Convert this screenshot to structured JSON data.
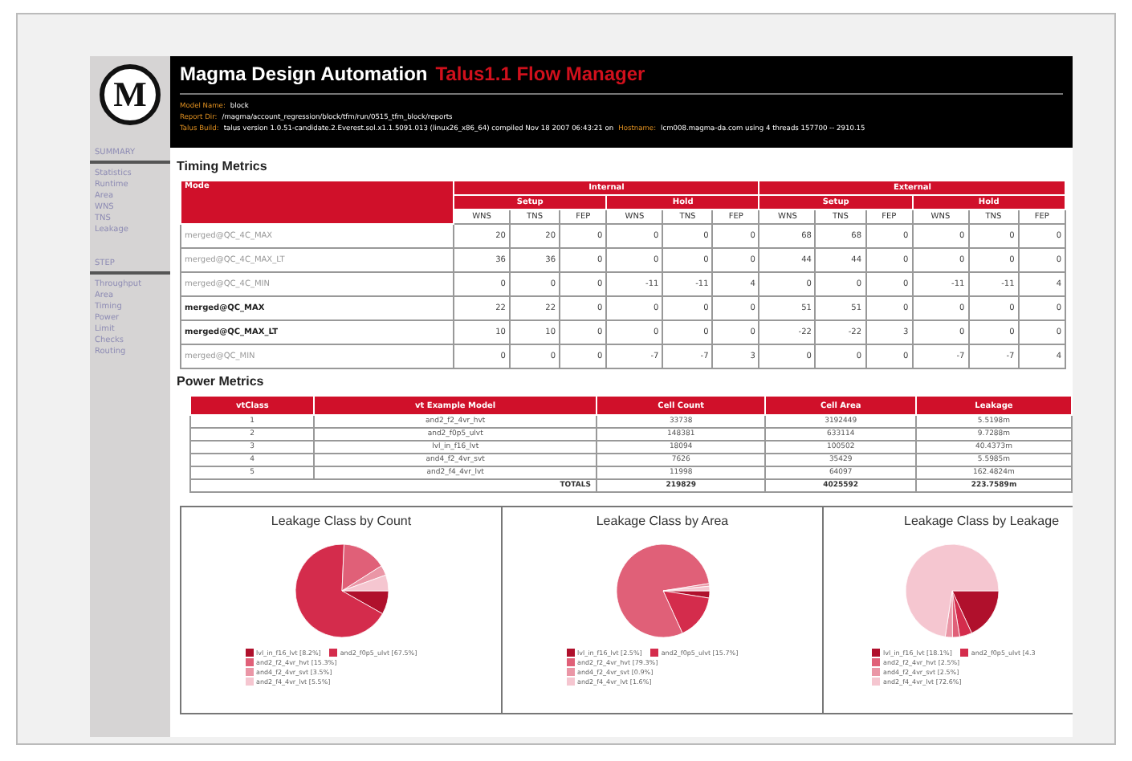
{
  "logo": {
    "text": "M"
  },
  "header": {
    "title": "Magma Design Automation",
    "subtitle": "Talus1.1 Flow Manager",
    "info": [
      {
        "label": "Model Name:",
        "value": "block"
      },
      {
        "label": "Report Dir:",
        "value": "/magma/account_regression/block/tfm/run/0515_tfm_block/reports"
      },
      {
        "label": "Talus Build:",
        "value": "talus version 1.0.51-candidate.2.Everest.sol.x1.1.5091.013 (linux26_x86_64) compiled Nov 18 2007 06:43:21 on",
        "label2": "Hostname:",
        "value2": "lcm008.magma-da.com using 4 threads 157700 -- 2910.15"
      }
    ]
  },
  "sidebar": {
    "sections": [
      {
        "heading": "SUMMARY",
        "items": [
          "Statistics",
          "Runtime",
          "Area",
          "WNS",
          "TNS",
          "Leakage"
        ]
      },
      {
        "heading": "STEP",
        "items": [
          "Throughput",
          "Area",
          "Timing",
          "Power",
          "Limit",
          "Checks",
          "Routing"
        ]
      }
    ]
  },
  "timing": {
    "title": "Timing Metrics",
    "mode_header": "Mode",
    "groups": [
      "Internal",
      "External"
    ],
    "subgroups": [
      "Setup",
      "Hold",
      "Setup",
      "Hold"
    ],
    "metrics": [
      "WNS",
      "TNS",
      "FEP",
      "WNS",
      "TNS",
      "FEP",
      "WNS",
      "TNS",
      "FEP",
      "WNS",
      "TNS",
      "FEP"
    ],
    "rows": [
      {
        "mode": "merged@QC_4C_MAX",
        "emphasized": false,
        "values": [
          "20",
          "20",
          "0",
          "0",
          "0",
          "0",
          "68",
          "68",
          "0",
          "0",
          "0",
          "0"
        ]
      },
      {
        "mode": "merged@QC_4C_MAX_LT",
        "emphasized": false,
        "values": [
          "36",
          "36",
          "0",
          "0",
          "0",
          "0",
          "44",
          "44",
          "0",
          "0",
          "0",
          "0"
        ]
      },
      {
        "mode": "merged@QC_4C_MIN",
        "emphasized": false,
        "values": [
          "0",
          "0",
          "0",
          "-11",
          "-11",
          "4",
          "0",
          "0",
          "0",
          "-11",
          "-11",
          "4"
        ]
      },
      {
        "mode": "merged@QC_MAX",
        "emphasized": true,
        "values": [
          "22",
          "22",
          "0",
          "0",
          "0",
          "0",
          "51",
          "51",
          "0",
          "0",
          "0",
          "0"
        ]
      },
      {
        "mode": "merged@QC_MAX_LT",
        "emphasized": true,
        "values": [
          "10",
          "10",
          "0",
          "0",
          "0",
          "0",
          "-22",
          "-22",
          "3",
          "0",
          "0",
          "0"
        ]
      },
      {
        "mode": "merged@QC_MIN",
        "emphasized": false,
        "values": [
          "0",
          "0",
          "0",
          "-7",
          "-7",
          "3",
          "0",
          "0",
          "0",
          "-7",
          "-7",
          "4"
        ]
      }
    ]
  },
  "power": {
    "title": "Power Metrics",
    "columns": [
      "vtClass",
      "vt Example Model",
      "Cell Count",
      "Cell Area",
      "Leakage"
    ],
    "rows": [
      [
        "1",
        "and2_f2_4vr_hvt",
        "33738",
        "3192449",
        "5.5198m"
      ],
      [
        "2",
        "and2_f0p5_ulvt",
        "148381",
        "633114",
        "9.7288m"
      ],
      [
        "3",
        "lvl_in_f16_lvt",
        "18094",
        "100502",
        "40.4373m"
      ],
      [
        "4",
        "and4_f2_4vr_svt",
        "7626",
        "35429",
        "5.5985m"
      ],
      [
        "5",
        "and2_f4_4vr_lvt",
        "11998",
        "64097",
        "162.4824m"
      ]
    ],
    "totals": {
      "label": "TOTALS",
      "values": [
        "219829",
        "4025592",
        "223.7589m"
      ]
    }
  },
  "charts": [
    {
      "chart_data": {
        "type": "pie",
        "title": "Leakage Class by Count",
        "categories": [
          "lvl_in_f16_lvt [8.2%]",
          "and2_f0p5_ulvt [67.5%]",
          "and2_f2_4vr_hvt [15.3%]",
          "and4_f2_4vr_svt [3.5%]",
          "and2_f4_4vr_lvt [5.5%]"
        ],
        "colors": [
          "#b0102c",
          "#d42c4c",
          "#e06078",
          "#ea96a6",
          "#f5c6d0"
        ],
        "values": [
          8.2,
          67.5,
          15.3,
          3.5,
          5.5
        ],
        "legend": true
      }
    },
    {
      "chart_data": {
        "type": "pie",
        "title": "Leakage Class by Area",
        "categories": [
          "lvl_in_f16_lvt [2.5%]",
          "and2_f0p5_ulvt [15.7%]",
          "and2_f2_4vr_hvt [79.3%]",
          "and4_f2_4vr_svt [0.9%]",
          "and2_f4_4vr_lvt [1.6%]"
        ],
        "colors": [
          "#b0102c",
          "#d42c4c",
          "#e06078",
          "#ea96a6",
          "#f5c6d0"
        ],
        "values": [
          2.5,
          15.7,
          79.3,
          0.9,
          1.6
        ],
        "legend": true
      }
    },
    {
      "chart_data": {
        "type": "pie",
        "title": "Leakage Class by Leakage",
        "categories": [
          "lvl_in_f16_lvt [18.1%]",
          "and2_f0p5_ulvt [4.3",
          "and2_f2_4vr_hvt [2.5%]",
          "and4_f2_4vr_svt [2.5%]",
          "and2_f4_4vr_lvt [72.6%]"
        ],
        "colors": [
          "#b0102c",
          "#d42c4c",
          "#e06078",
          "#ea96a6",
          "#f5c6d0"
        ],
        "values": [
          18.1,
          4.3,
          2.5,
          2.5,
          72.6
        ],
        "legend": true
      }
    }
  ]
}
